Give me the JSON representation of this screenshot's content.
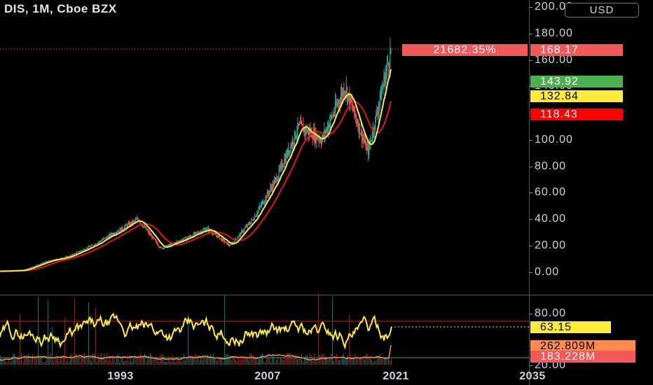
{
  "header": {
    "symbol_label": "DIS, 1M, Cboe BZX"
  },
  "currency_button": "USD",
  "percent_change": "21682.35%",
  "price_axis": {
    "ticks": [
      "200.00",
      "180.00",
      "160.00",
      "140.00",
      "100.00",
      "80.00",
      "60.00",
      "40.00",
      "20.00",
      "0.00"
    ]
  },
  "price_badges": {
    "last_price": {
      "text": "168.17",
      "color": "#f0585a"
    },
    "green_badge": {
      "text": "143.92",
      "color": "#4caf50"
    },
    "yellow_badge": {
      "text": "132.84",
      "color": "#ffeb3b"
    },
    "red_badge": {
      "text": "118.43",
      "color": "#ff0000"
    }
  },
  "indicator_axis": {
    "ticks": [
      "80.00",
      "20.00"
    ],
    "rsi_badge": {
      "text": "63.15",
      "color": "#ffeb3b"
    },
    "volume_badge": {
      "text": "262.809M",
      "color": "#ff8a50"
    },
    "volume_ma_badge": {
      "text": "183.228M",
      "color": "#f0585a"
    }
  },
  "time_axis": {
    "ticks": [
      "1993",
      "2007",
      "2021",
      "2035"
    ]
  },
  "colors": {
    "up": "#26a69a",
    "down": "#ef5350",
    "ma_fast": "#ffeb3b",
    "ma_slow": "#e0141b",
    "rsi": "#ffeb3b",
    "rsi_ma": "#ff8a50"
  },
  "chart_data": {
    "type": "line",
    "title": "DIS, 1M, Cboe BZX",
    "x": [
      "1980",
      "1985",
      "1990",
      "1993",
      "1996",
      "1998",
      "2000",
      "2002",
      "2004",
      "2007",
      "2009",
      "2011",
      "2013",
      "2015",
      "2017",
      "2019",
      "2020",
      "2021"
    ],
    "series": [
      {
        "name": "DIS",
        "values": [
          0.8,
          1.5,
          8,
          12,
          20,
          30,
          40,
          18,
          25,
          33,
          20,
          40,
          70,
          110,
          100,
          140,
          90,
          168.17
        ]
      }
    ],
    "ylim": [
      0,
      200
    ]
  }
}
